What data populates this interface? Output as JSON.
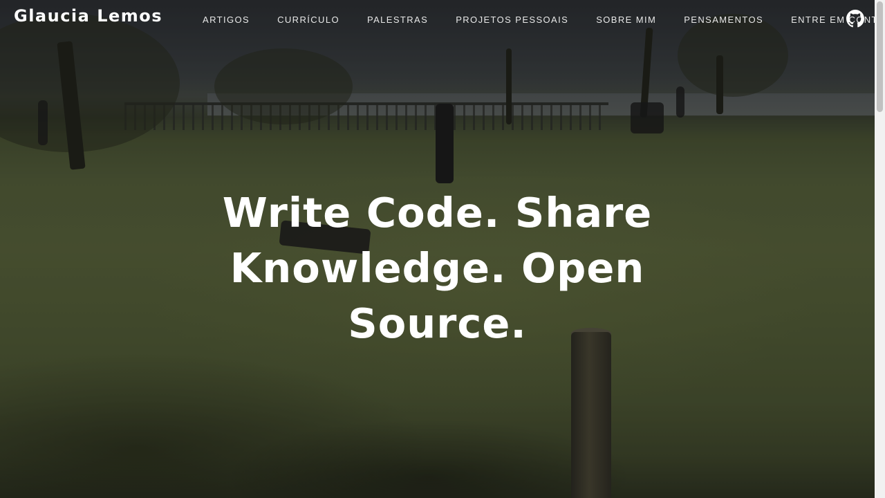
{
  "site": {
    "brand": "Glaucia Lemos"
  },
  "nav": {
    "items": [
      {
        "label": "ARTIGOS"
      },
      {
        "label": "CURRÍCULO"
      },
      {
        "label": "PALESTRAS"
      },
      {
        "label": "PROJETOS PESSOAIS"
      },
      {
        "label": "SOBRE MIM"
      },
      {
        "label": "PENSAMENTOS"
      },
      {
        "label": "ENTRE EM CONTATO"
      }
    ],
    "github_icon": "github-icon"
  },
  "hero": {
    "line1": "Write Code. Share",
    "line2": "Knowledge. Open",
    "line3": "Source."
  },
  "colors": {
    "text": "#ffffff",
    "nav_text": "#e9e9e9",
    "scrollbar_track": "#f1f1f1",
    "scrollbar_thumb": "#c1c1c1"
  }
}
